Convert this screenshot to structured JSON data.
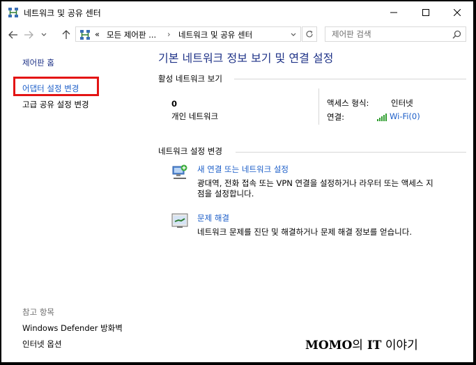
{
  "window": {
    "title": "네트워크 및 공유 센터"
  },
  "address_bar": {
    "overflow": "«",
    "crumbs": [
      "모든 제어판 ...",
      "네트워크 및 공유 센터"
    ]
  },
  "search": {
    "placeholder": "제어판 검색"
  },
  "sidebar": {
    "home": "제어판 홈",
    "links": [
      "어댑터 설정 변경",
      "고급 공유 설정 변경"
    ],
    "see_also_title": "참고 항목",
    "see_also": [
      "Windows Defender 방화벽",
      "인터넷 옵션"
    ]
  },
  "main": {
    "heading": "기본 네트워크 정보 보기 및 연결 설정",
    "active_networks": {
      "title": "활성 네트워크 보기",
      "network_name": "0",
      "network_type": "개인 네트워크",
      "access_type_label": "액세스 형식:",
      "access_type_value": "인터넷",
      "connection_label": "연결:",
      "connection_value": "Wi-Fi(0)"
    },
    "change_settings": {
      "title": "네트워크 설정 변경",
      "tasks": [
        {
          "link": "새 연결 또는 네트워크 설정",
          "desc_line1": "광대역, 전화 접속 또는 VPN 연결을 설정하거나 라우터 또는 액세스 지",
          "desc_line2": "점을 설정합니다."
        },
        {
          "link": "문제 해결",
          "desc_line1": "네트워크 문제를 진단 및 해결하거나 문제 해결 정보를 얻습니다."
        }
      ]
    }
  },
  "watermark": {
    "brand": "MOMO",
    "particle1": "의",
    "it": "IT",
    "particle2": " 이야기"
  },
  "colors": {
    "link": "#1c5ec8",
    "heading": "#1e3287",
    "highlight": "#e31414",
    "wifi": "#2f9e2f"
  }
}
